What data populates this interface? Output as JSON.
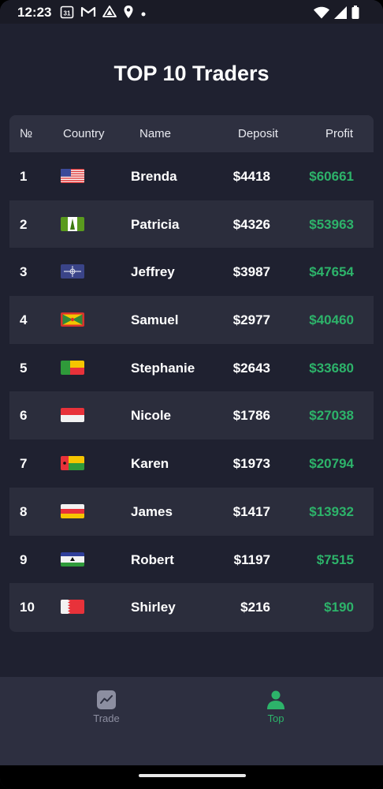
{
  "status": {
    "time": "12:23",
    "calendar_day": "31"
  },
  "title": "TOP 10 Traders",
  "columns": {
    "num": "№",
    "country": "Country",
    "name": "Name",
    "deposit": "Deposit",
    "profit": "Profit"
  },
  "rows": [
    {
      "num": "1",
      "flag": "usa",
      "name": "Brenda",
      "deposit": "$4418",
      "profit": "$60661"
    },
    {
      "num": "2",
      "flag": "norfolk",
      "name": "Patricia",
      "deposit": "$4326",
      "profit": "$53963"
    },
    {
      "num": "3",
      "flag": "nato",
      "name": "Jeffrey",
      "deposit": "$3987",
      "profit": "$47654"
    },
    {
      "num": "4",
      "flag": "grenada",
      "name": "Samuel",
      "deposit": "$2977",
      "profit": "$40460"
    },
    {
      "num": "5",
      "flag": "benin",
      "name": "Stephanie",
      "deposit": "$2643",
      "profit": "$33680"
    },
    {
      "num": "6",
      "flag": "monaco",
      "name": "Nicole",
      "deposit": "$1786",
      "profit": "$27038"
    },
    {
      "num": "7",
      "flag": "guinea-bissau",
      "name": "Karen",
      "deposit": "$1973",
      "profit": "$20794"
    },
    {
      "num": "8",
      "flag": "south-ossetia",
      "name": "James",
      "deposit": "$1417",
      "profit": "$13932"
    },
    {
      "num": "9",
      "flag": "lesotho",
      "name": "Robert",
      "deposit": "$1197",
      "profit": "$7515"
    },
    {
      "num": "10",
      "flag": "bahrain",
      "name": "Shirley",
      "deposit": "$216",
      "profit": "$190"
    }
  ],
  "nav": {
    "trade_label": "Trade",
    "top_label": "Top"
  },
  "colors": {
    "background": "#1f2130",
    "profit": "#2db36a",
    "active_tab": "#2db36a",
    "inactive_tab": "#8c8ea0"
  }
}
